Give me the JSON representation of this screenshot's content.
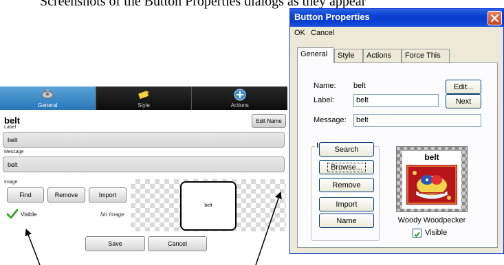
{
  "caption": "Screenshots of the Button Properties dialogs as they appear",
  "mobile": {
    "tabs": [
      {
        "label": "General",
        "active": true,
        "icon": "gear-icon"
      },
      {
        "label": "Style",
        "active": false,
        "icon": "pencil-icon"
      },
      {
        "label": "Actions",
        "active": false,
        "icon": "plus-circle-icon"
      }
    ],
    "button_name": "belt",
    "edit_name_label": "Edit Name",
    "label_caption": "Label",
    "label_value": "belt",
    "message_caption": "Message",
    "message_value": "belt",
    "image_caption": "Image",
    "find_label": "Find",
    "remove_label": "Remove",
    "import_label": "Import",
    "visible_label": "Visible",
    "no_image_text": "No Image",
    "preview_label": "belt",
    "save_label": "Save",
    "cancel_label": "Cancel",
    "check_color": "#3aa32a",
    "tab_active_color": "#3d8ccb"
  },
  "dialog": {
    "title": "Button Properties",
    "menu": {
      "ok": "OK",
      "cancel": "Cancel"
    },
    "tabs": [
      "General",
      "Style",
      "Actions",
      "Force This"
    ],
    "name_caption": "Name:",
    "name_value": "belt",
    "edit_label": "Edit...",
    "label_caption": "Label:",
    "label_value": "belt",
    "next_label": "Next",
    "message_caption": "Message:",
    "message_value": "belt",
    "image_group_label": "Image",
    "search_label": "Search",
    "browse_label": "Browse...",
    "remove_label": "Remove",
    "import_label": "Import",
    "name_button_label": "Name",
    "preview_label": "belt",
    "image_caption": "Woody Woodpecker",
    "visible_label": "Visible",
    "visible_checked": true,
    "title_bar_color": "#0a3fd0",
    "close_button_color": "#d8583a"
  }
}
